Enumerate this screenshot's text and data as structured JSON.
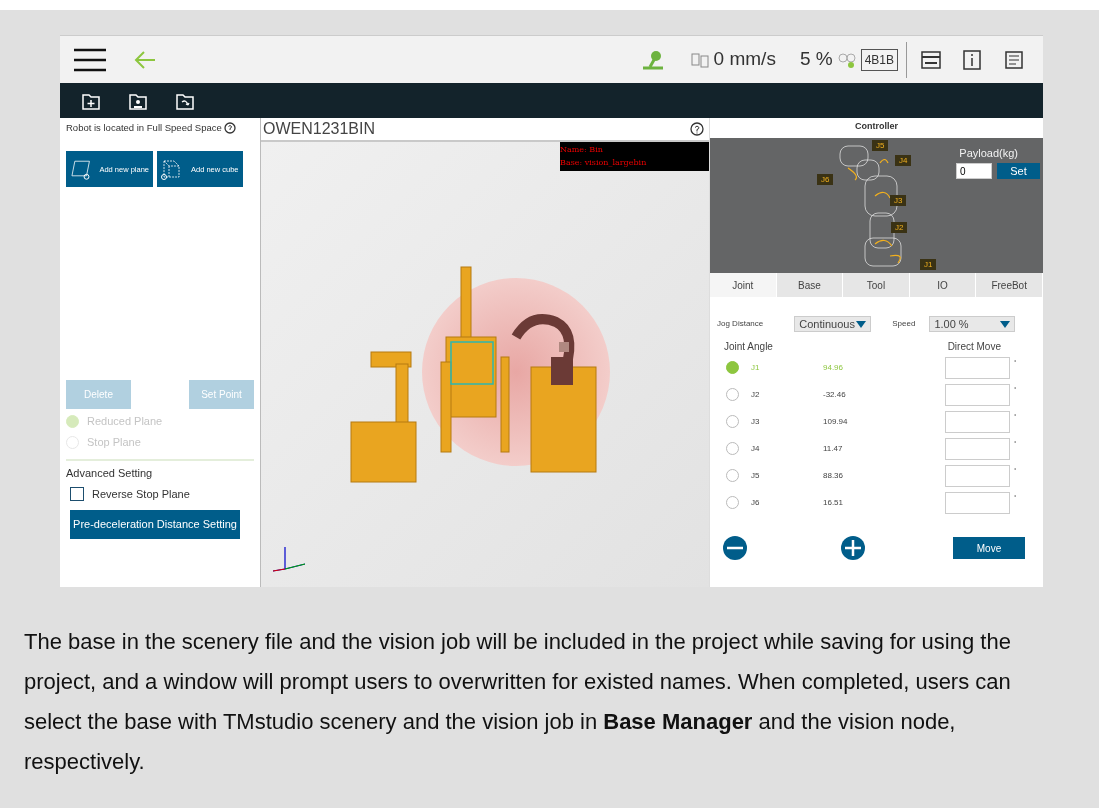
{
  "top_bar": {
    "speed": "0 mm/s",
    "speed_percent": "5 %",
    "mode_badge": "4B1B"
  },
  "left_panel": {
    "status": "Robot is located in Full Speed Space",
    "add_buttons": [
      "Add new plane",
      "Add new cube"
    ],
    "delete_button": {
      "label": "Delete",
      "disabled": true
    },
    "set_point_button": {
      "label": "Set Point",
      "disabled": true
    },
    "plane_types": [
      {
        "label": "Reduced Plane",
        "selected": true,
        "disabled": true
      },
      {
        "label": "Stop Plane",
        "selected": false,
        "disabled": true
      }
    ],
    "advanced_heading": "Advanced Setting",
    "reverse_stop_plane": {
      "label": "Reverse Stop Plane",
      "checked": false
    },
    "pre_deceleration_button": "Pre-deceleration Distance Setting"
  },
  "scene": {
    "title": "OWEN1231BIN",
    "info_lines": [
      "Name: Bin",
      "Base: vision_largebin"
    ]
  },
  "controller": {
    "title": "Controller",
    "payload_label": "Payload(kg)",
    "payload_value": "0",
    "set_button": "Set",
    "diagram_labels": [
      "J5",
      "J4",
      "J6",
      "J3",
      "J2",
      "J1"
    ],
    "tabs": [
      {
        "label": "Joint",
        "selected": true
      },
      {
        "label": "Base",
        "selected": false
      },
      {
        "label": "Tool",
        "selected": false
      },
      {
        "label": "IO",
        "selected": false
      },
      {
        "label": "FreeBot",
        "selected": false
      }
    ],
    "jog_distance_label": "Jog Distance",
    "jog_distance_value": "Continuous",
    "speed_label": "Speed",
    "speed_value": "1.00 %",
    "joint_angle_heading": "Joint Angle",
    "direct_move_heading": "Direct Move",
    "joints": [
      {
        "name": "J1",
        "value": "94.96",
        "selected": true,
        "unit": "°"
      },
      {
        "name": "J2",
        "value": "-32.46",
        "selected": false,
        "unit": "°"
      },
      {
        "name": "J3",
        "value": "109.94",
        "selected": false,
        "unit": "°"
      },
      {
        "name": "J4",
        "value": "11.47",
        "selected": false,
        "unit": "°"
      },
      {
        "name": "J5",
        "value": "88.36",
        "selected": false,
        "unit": "°"
      },
      {
        "name": "J6",
        "value": "16.51",
        "selected": false,
        "unit": "°"
      }
    ],
    "move_button": "Move"
  },
  "caption": "The base in the scenery file and the vision job will be included in the project while saving for using the project, and a window will prompt users to overwritten for existed names. When completed, users can select the base with TMstudio scenery and the vision job in **Base Manager** and the vision node, respectively."
}
